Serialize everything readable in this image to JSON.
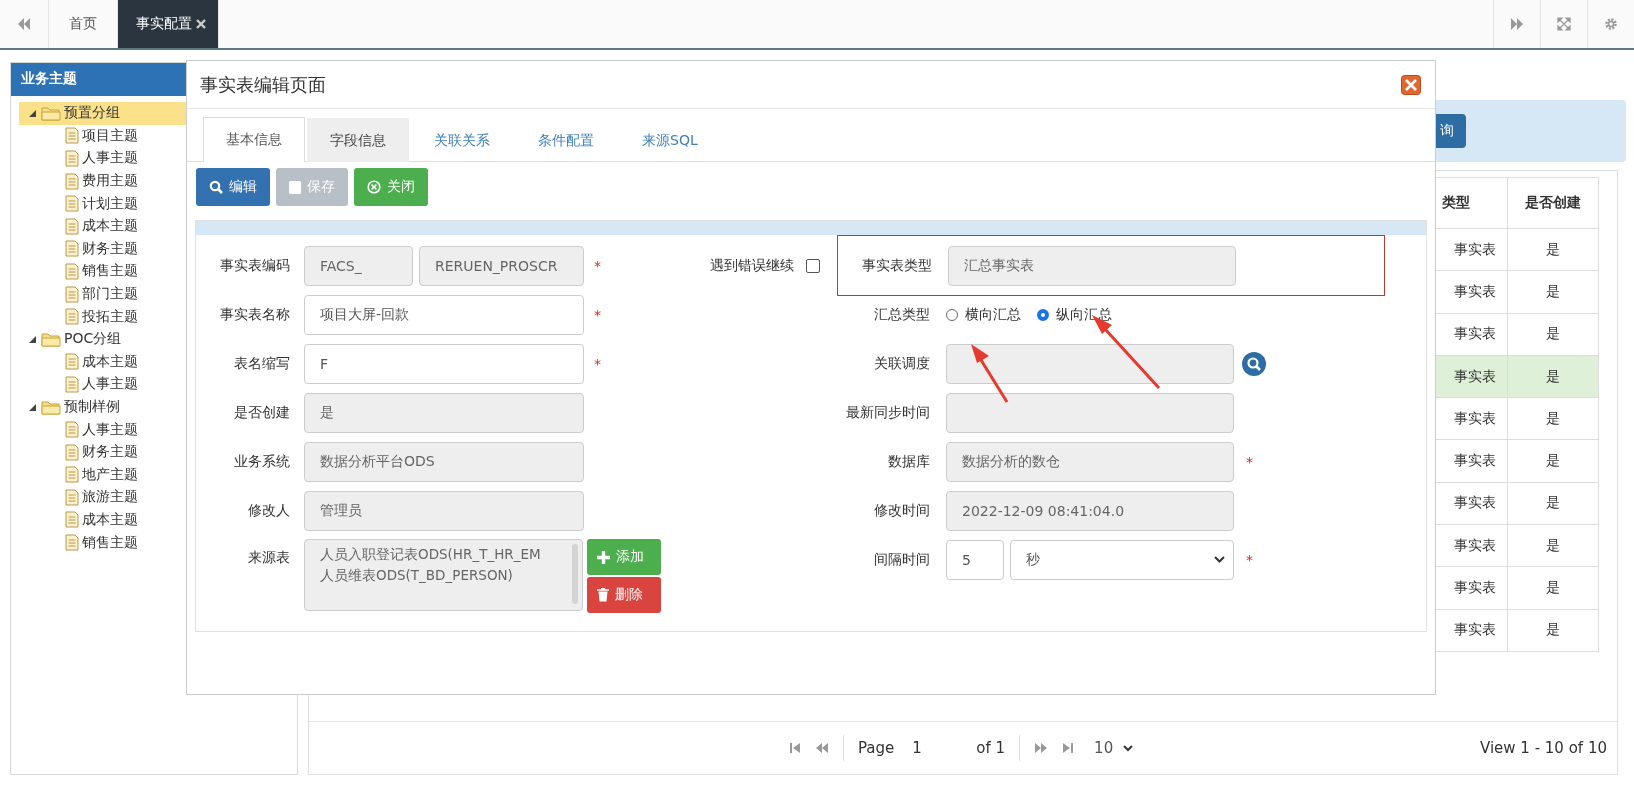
{
  "top_tabs": [
    {
      "label": "首页",
      "selected": false
    },
    {
      "label": "事实配置",
      "selected": true
    }
  ],
  "sidebar": {
    "title": "业务主题",
    "tree": [
      {
        "label": "预置分组",
        "kind": "folder",
        "expanded": true,
        "selected": true,
        "children": [
          {
            "label": "项目主题",
            "kind": "doc",
            "selected": false
          },
          {
            "label": "人事主题",
            "kind": "doc",
            "selected": false
          },
          {
            "label": "费用主题",
            "kind": "doc",
            "selected": false
          },
          {
            "label": "计划主题",
            "kind": "doc",
            "selected": false
          },
          {
            "label": "成本主题",
            "kind": "doc",
            "selected": false
          },
          {
            "label": "财务主题",
            "kind": "doc",
            "selected": false
          },
          {
            "label": "销售主题",
            "kind": "doc",
            "selected": false
          },
          {
            "label": "部门主题",
            "kind": "doc",
            "selected": false
          },
          {
            "label": "投拓主题",
            "kind": "doc",
            "selected": false
          }
        ]
      },
      {
        "label": "POC分组",
        "kind": "folder",
        "expanded": true,
        "selected": false,
        "children": [
          {
            "label": "成本主题",
            "kind": "doc",
            "selected": false
          },
          {
            "label": "人事主题",
            "kind": "doc",
            "selected": false
          }
        ]
      },
      {
        "label": "预制样例",
        "kind": "folder",
        "expanded": true,
        "selected": false,
        "children": [
          {
            "label": "人事主题",
            "kind": "doc",
            "selected": false
          },
          {
            "label": "财务主题",
            "kind": "doc",
            "selected": false
          },
          {
            "label": "地产主题",
            "kind": "doc",
            "selected": false
          },
          {
            "label": "旅游主题",
            "kind": "doc",
            "selected": false
          },
          {
            "label": "成本主题",
            "kind": "doc",
            "selected": false
          },
          {
            "label": "销售主题",
            "kind": "doc",
            "selected": false
          }
        ]
      }
    ]
  },
  "query": {
    "button": "询"
  },
  "table": {
    "columns": [
      "类型",
      "是否创建"
    ],
    "rows": [
      {
        "cells": [
          "事实表",
          "是"
        ],
        "selected": false
      },
      {
        "cells": [
          "事实表",
          "是"
        ],
        "selected": false
      },
      {
        "cells": [
          "事实表",
          "是"
        ],
        "selected": false
      },
      {
        "cells": [
          "事实表",
          "是"
        ],
        "selected": true
      },
      {
        "cells": [
          "事实表",
          "是"
        ],
        "selected": false
      },
      {
        "cells": [
          "事实表",
          "是"
        ],
        "selected": false
      },
      {
        "cells": [
          "事实表",
          "是"
        ],
        "selected": false
      },
      {
        "cells": [
          "事实表",
          "是"
        ],
        "selected": false
      },
      {
        "cells": [
          "事实表",
          "是"
        ],
        "selected": false
      },
      {
        "cells": [
          "事实表",
          "是"
        ],
        "selected": false
      }
    ]
  },
  "pagination": {
    "page_label": "Page",
    "page": "1",
    "of": "of 1",
    "page_size": "10",
    "summary": "View 1 - 10 of 10"
  },
  "dialog": {
    "title": "事实表编辑页面",
    "tabs": [
      {
        "label": "基本信息",
        "selected": true,
        "hovered": false
      },
      {
        "label": "字段信息",
        "selected": false,
        "hovered": true
      },
      {
        "label": "关联关系",
        "selected": false,
        "hovered": false
      },
      {
        "label": "条件配置",
        "selected": false,
        "hovered": false
      },
      {
        "label": "来源SQL",
        "selected": false,
        "hovered": false
      }
    ],
    "buttons": [
      {
        "label": "编辑",
        "kind": "edit",
        "disabled": false
      },
      {
        "label": "保存",
        "kind": "save",
        "disabled": true
      },
      {
        "label": "关闭",
        "kind": "close",
        "disabled": false
      }
    ],
    "left_fields": [
      {
        "label": "事实表编码",
        "kind": "double",
        "values": [
          "FACS_",
          "RERUEN_PROSCR"
        ],
        "editable": false,
        "required_mark": "*"
      },
      {
        "label": "事实表名称",
        "kind": "text",
        "values": [
          "项目大屏-回款"
        ],
        "editable": true,
        "required_mark": "*"
      },
      {
        "label": "表名缩写",
        "kind": "text",
        "values": [
          "F"
        ],
        "editable": true,
        "required_mark": "*"
      },
      {
        "label": "是否创建",
        "kind": "text",
        "values": [
          "是"
        ],
        "editable": false
      },
      {
        "label": "业务系统",
        "kind": "text",
        "values": [
          "数据分析平台ODS"
        ],
        "editable": false
      },
      {
        "label": "修改人",
        "kind": "text",
        "values": [
          "管理员"
        ],
        "editable": false
      },
      {
        "label": "来源表",
        "kind": "list",
        "values": [
          "人员入职登记表ODS(HR_T_HR_EM",
          "人员维表ODS(T_BD_PERSON)"
        ],
        "editable": false,
        "actions": [
          {
            "label": "添加",
            "kind": "add"
          },
          {
            "label": "删除",
            "kind": "delete"
          }
        ]
      }
    ],
    "continue_on_error": {
      "label": "遇到错误继续",
      "checked": false
    },
    "right_fields": [
      {
        "label": "事实表类型",
        "kind": "text",
        "value": "汇总事实表",
        "highlighted": true
      },
      {
        "label": "汇总类型",
        "kind": "radio",
        "options": [
          {
            "label": "横向汇总",
            "selected": false
          },
          {
            "label": "纵向汇总",
            "selected": true
          }
        ],
        "highlighted": false
      },
      {
        "label": "关联调度",
        "kind": "lookup",
        "highlighted": false
      },
      {
        "label": "最新同步时间",
        "kind": "text",
        "highlighted": false
      },
      {
        "label": "数据库",
        "kind": "text",
        "value": "数据分析的数仓",
        "highlighted": false,
        "required_mark": "*"
      },
      {
        "label": "修改时间",
        "kind": "text",
        "value": "2022-12-09 08:41:04.0",
        "highlighted": false
      },
      {
        "label": "间隔时间",
        "kind": "interval",
        "number": "5",
        "unit": "秒",
        "highlighted": false,
        "required_mark": "*"
      }
    ]
  }
}
